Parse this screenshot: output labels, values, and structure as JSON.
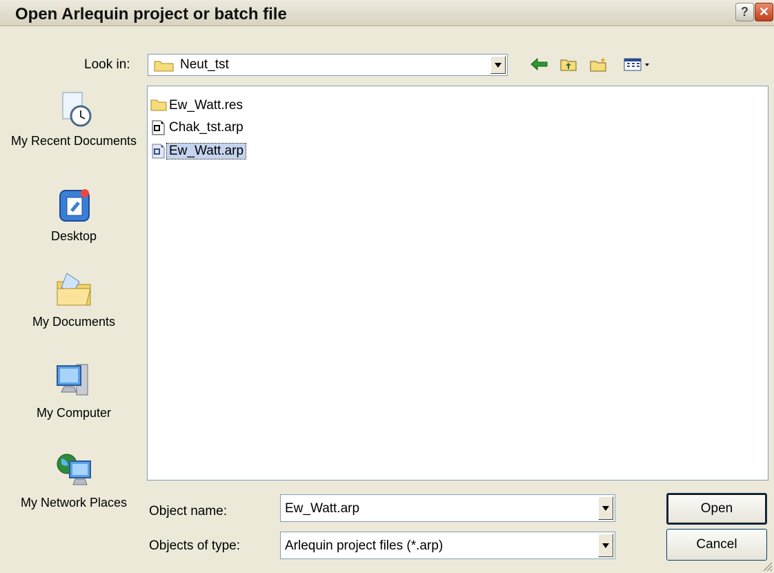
{
  "window": {
    "title": "Open Arlequin project or batch file",
    "help_label": "?",
    "close_label": "✕"
  },
  "look_in": {
    "label": "Look in:",
    "value": "Neut_tst"
  },
  "toolbar": {
    "icons": [
      "back-icon",
      "up-folder-icon",
      "new-folder-icon",
      "view-menu-icon"
    ]
  },
  "places": [
    {
      "label": "My Recent Documents",
      "icon": "recent-documents-icon"
    },
    {
      "label": "Desktop",
      "icon": "desktop-icon"
    },
    {
      "label": "My Documents",
      "icon": "my-documents-icon"
    },
    {
      "label": "My Computer",
      "icon": "my-computer-icon"
    },
    {
      "label": "My Network Places",
      "icon": "network-places-icon"
    }
  ],
  "files": [
    {
      "name": "Ew_Watt.res",
      "type": "folder",
      "selected": false
    },
    {
      "name": "Chak_tst.arp",
      "type": "arp",
      "selected": false
    },
    {
      "name": "Ew_Watt.arp",
      "type": "arp",
      "selected": true
    }
  ],
  "object_name": {
    "label": "Object name:",
    "value": "Ew_Watt.arp"
  },
  "object_type": {
    "label": "Objects of type:",
    "value": "Arlequin project files (*.arp)"
  },
  "buttons": {
    "open": "Open",
    "cancel": "Cancel"
  }
}
